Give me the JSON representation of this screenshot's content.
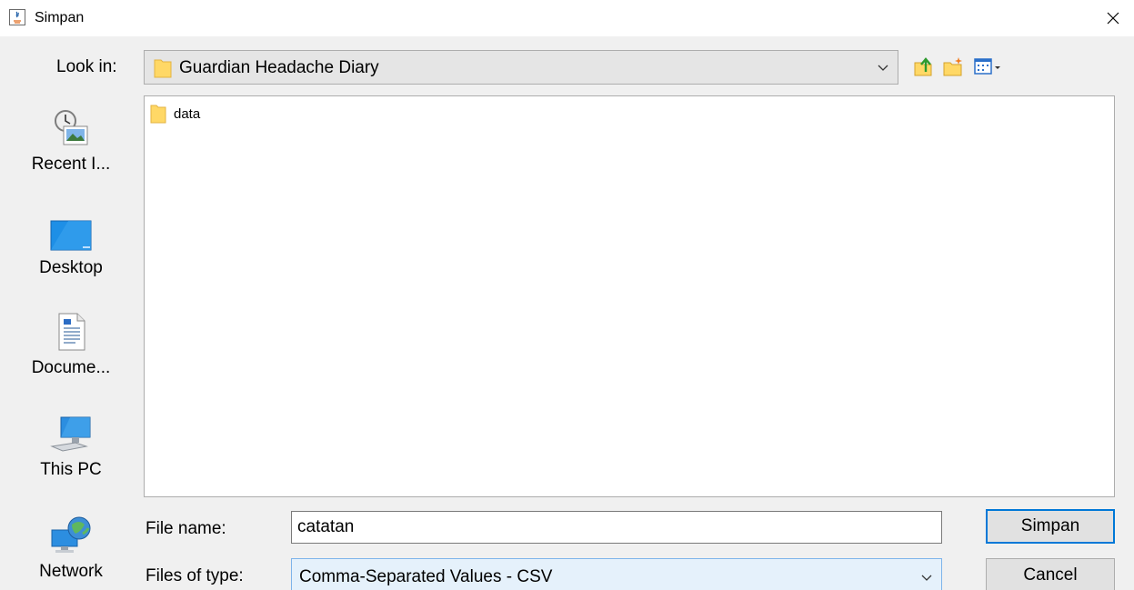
{
  "window": {
    "title": "Simpan"
  },
  "toolbar": {
    "look_in_label": "Look in:",
    "look_in_value": "Guardian Headache Diary"
  },
  "places": [
    {
      "label": "Recent I...",
      "icon": "recent-items-icon"
    },
    {
      "label": "Desktop",
      "icon": "desktop-icon"
    },
    {
      "label": "Docume...",
      "icon": "documents-icon"
    },
    {
      "label": "This PC",
      "icon": "computer-icon"
    },
    {
      "label": "Network",
      "icon": "network-icon"
    }
  ],
  "files": [
    {
      "name": "data",
      "icon": "folder-icon"
    }
  ],
  "form": {
    "file_name_label": "File name:",
    "file_name_value": "catatan",
    "file_type_label": "Files of type:",
    "file_type_value": "Comma-Separated Values - CSV"
  },
  "buttons": {
    "save": "Simpan",
    "cancel": "Cancel"
  },
  "colors": {
    "accent": "#0078d7",
    "folder": "#ffd866",
    "selection": "#e5f1fb"
  }
}
